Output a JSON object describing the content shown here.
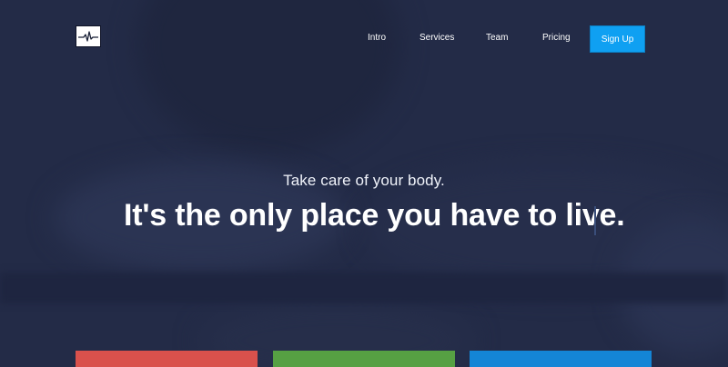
{
  "header": {
    "logo_icon": "heartbeat-icon",
    "nav": [
      {
        "label": "Intro"
      },
      {
        "label": "Services"
      },
      {
        "label": "Team"
      },
      {
        "label": "Pricing"
      }
    ],
    "signup_label": "Sign Up"
  },
  "hero": {
    "subtitle": "Take care of your body.",
    "title": "It's the only place you have to live."
  },
  "colors": {
    "background": "#232b47",
    "accent": "#0fa0f2",
    "card_red": "#d9514c",
    "card_green": "#56a043",
    "card_blue": "#1485d6"
  }
}
